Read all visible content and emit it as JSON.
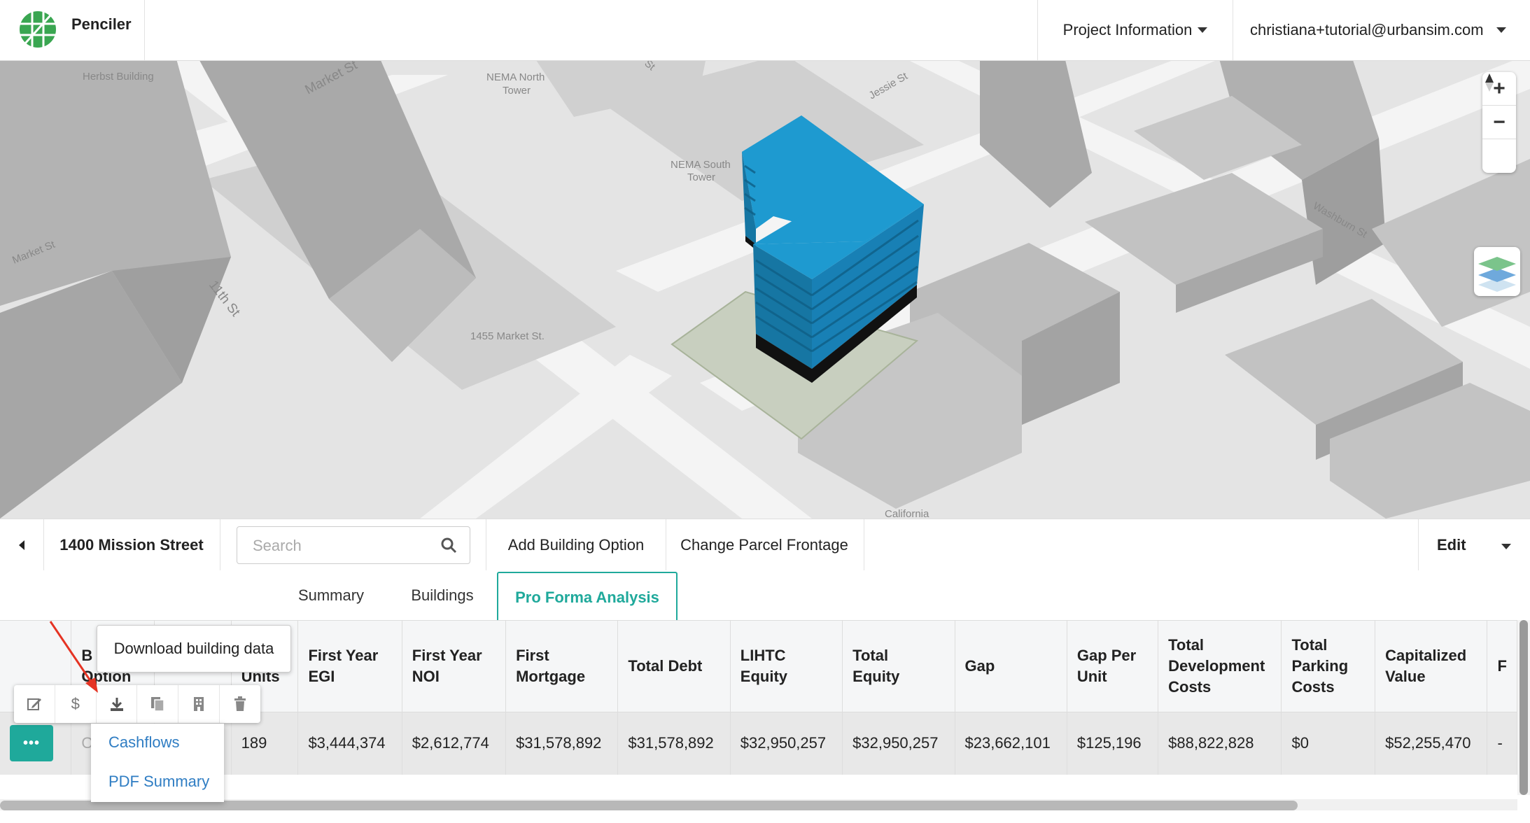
{
  "app": {
    "name": "Penciler"
  },
  "header": {
    "project_menu": "Project Information",
    "user_email": "christiana+tutorial@urbansim.com"
  },
  "map": {
    "labels": {
      "herbst": "Herbst Building",
      "market1": "Market St",
      "market2": "Market St",
      "nema_north": "NEMA North Tower",
      "nema_north_l1": "NEMA North",
      "nema_north_l2": "Tower",
      "nema_south_l1": "NEMA South",
      "nema_south_l2": "Tower",
      "jessie": "Jessie St",
      "washburn": "Washburn St",
      "eleventh": "11th St",
      "market1455": "1455 Market St.",
      "california": "California",
      "top_st": "St"
    },
    "controls": {
      "zoom_in": "+",
      "zoom_out": "−"
    },
    "building_color": "#1e9ad0"
  },
  "toolbar": {
    "address": "1400 Mission Street",
    "search_placeholder": "Search",
    "add_option": "Add Building Option",
    "change_frontage": "Change Parcel Frontage",
    "edit": "Edit"
  },
  "tabs": [
    {
      "label": "Summary",
      "active": false
    },
    {
      "label": "Buildings",
      "active": false
    },
    {
      "label": "Pro Forma Analysis",
      "active": true
    }
  ],
  "table": {
    "headers": [
      "",
      "Building Option",
      "",
      "Units",
      "First Year EGI",
      "First Year NOI",
      "First Mortgage",
      "Total Debt",
      "LIHTC Equity",
      "Total Equity",
      "Gap",
      "Gap Per Unit",
      "Total Development Costs",
      "Total Parking Costs",
      "Capitalized Value",
      "F"
    ],
    "header_lines": {
      "b": "B",
      "option": "Option",
      "units": "Units",
      "fy_egi": [
        "First Year",
        "EGI"
      ],
      "fy_noi": [
        "First Year",
        "NOI"
      ],
      "first_mortgage": [
        "First",
        "Mortgage"
      ],
      "total_debt": "Total Debt",
      "lihtc": [
        "LIHTC",
        "Equity"
      ],
      "total_equity": [
        "Total",
        "Equity"
      ],
      "gap": "Gap",
      "gap_per_unit": [
        "Gap Per",
        "Unit"
      ],
      "tdc": [
        "Total",
        "Development",
        "Costs"
      ],
      "tpc": [
        "Total",
        "Parking",
        "Costs"
      ],
      "cap_value": [
        "Capitalized",
        "Value"
      ],
      "f": "F"
    },
    "row": {
      "menu": "•••",
      "option": "Op",
      "hidden_cell": "0",
      "units": "189",
      "fy_egi": "$3,444,374",
      "fy_noi": "$2,612,774",
      "first_mortgage": "$31,578,892",
      "total_debt": "$31,578,892",
      "lihtc": "$32,950,257",
      "total_equity": "$32,950,257",
      "gap": "$23,662,101",
      "gap_per_unit": "$125,196",
      "tdc": "$88,822,828",
      "tpc": "$0",
      "cap_value": "$52,255,470",
      "f": "-"
    }
  },
  "tooltip": "Download building data",
  "actions": [
    "edit-icon",
    "dollar-icon",
    "download-icon",
    "copy-icon",
    "building-icon",
    "trash-icon"
  ],
  "dollar_glyph": "$",
  "download_menu": [
    "Cashflows",
    "PDF Summary"
  ],
  "colors": {
    "accent": "#1fa99b",
    "link": "#2f7dc3",
    "arrow": "#e53323"
  }
}
